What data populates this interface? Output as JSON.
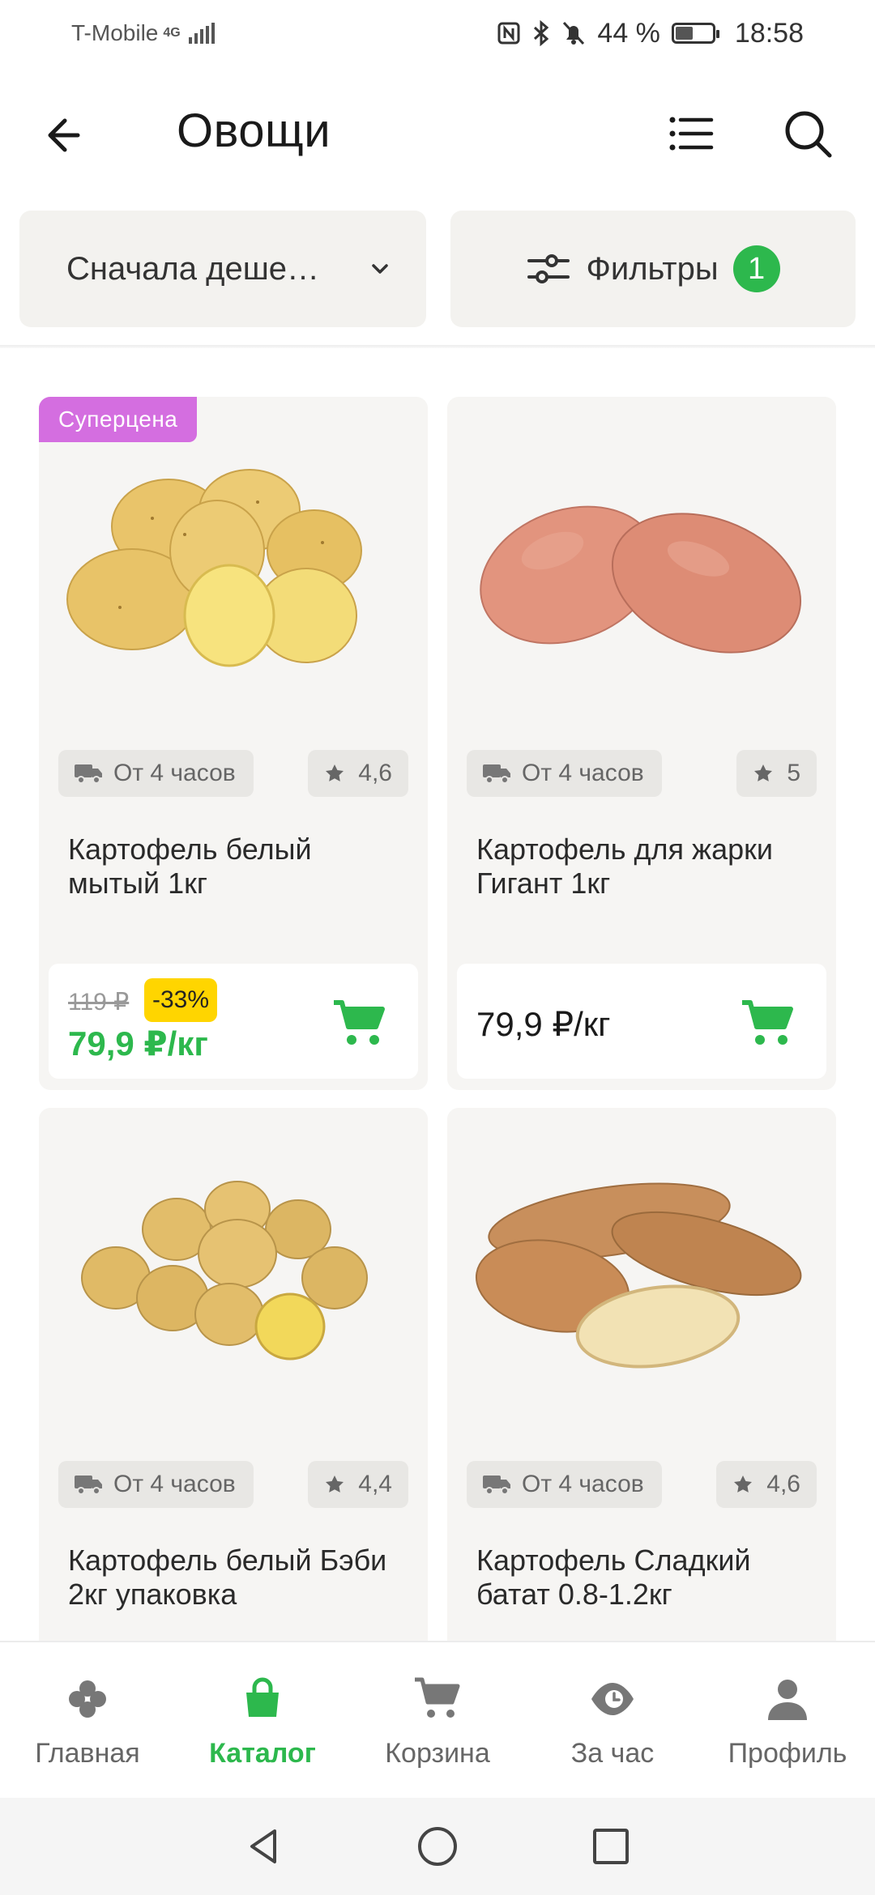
{
  "status_bar": {
    "carrier": "T-Mobile",
    "network": "4G",
    "battery_percent": "44 %",
    "battery_level": 0.44,
    "time": "18:58"
  },
  "header": {
    "title": "Овощи",
    "icons": {
      "back": "arrow-left-icon",
      "list": "list-icon",
      "search": "search-icon"
    }
  },
  "controls": {
    "sort_label": "Сначала деше…",
    "filter_label": "Фильтры",
    "filter_count": "1"
  },
  "products": [
    {
      "promo": "Суперцена",
      "delivery": "От 4 часов",
      "rating": "4,6",
      "name": "Картофель белый мытый 1кг",
      "old_price": "119 ₽",
      "discount": "-33%",
      "price": "79,9 ₽/кг"
    },
    {
      "delivery": "От 4 часов",
      "rating": "5",
      "name": "Картофель для жарки Гигант 1кг",
      "price": "79,9 ₽/кг"
    },
    {
      "delivery": "От 4 часов",
      "rating": "4,4",
      "name": "Картофель белый Бэби 2кг упаковка"
    },
    {
      "delivery": "От 4 часов",
      "rating": "4,6",
      "name": "Картофель Сладкий батат 0.8-1.2кг"
    }
  ],
  "bottom_nav": [
    {
      "label": "Главная",
      "icon": "home-icon"
    },
    {
      "label": "Каталог",
      "icon": "bag-icon",
      "active": true
    },
    {
      "label": "Корзина",
      "icon": "cart-icon"
    },
    {
      "label": "За час",
      "icon": "clock-eye-icon"
    },
    {
      "label": "Профиль",
      "icon": "profile-icon"
    }
  ],
  "colors": {
    "accent_green": "#2db84d",
    "promo_purple": "#d46ee0",
    "discount_yellow": "#ffd500",
    "card_bg": "#f6f5f3"
  }
}
